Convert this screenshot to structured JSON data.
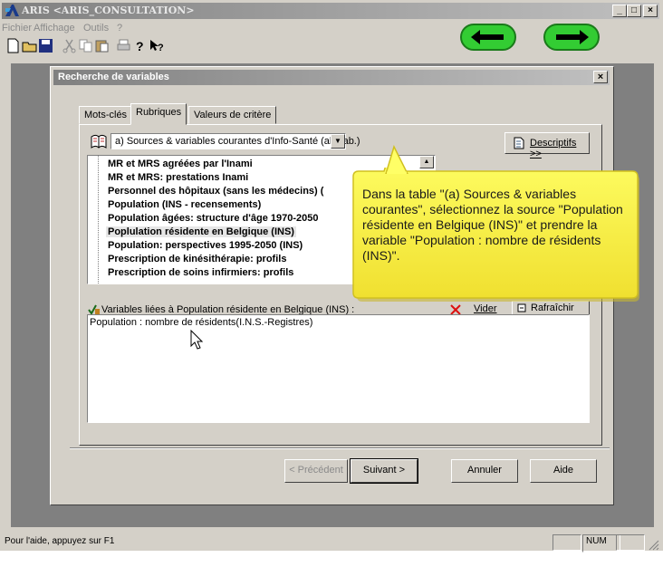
{
  "app": {
    "title": "ARIS <ARIS_CONSULTATION>",
    "menu": [
      "Fichier",
      "Affichage",
      "Outils",
      "?"
    ],
    "window_buttons": [
      "_",
      "□",
      "×"
    ]
  },
  "dialog": {
    "title": "Recherche de variables",
    "close": "×",
    "tabs": [
      "Mots-clés",
      "Rubriques",
      "Valeurs de critère"
    ],
    "combo_value": "a)  Sources & variables courantes d'Info-Santé (alphab.)",
    "descriptifs_button": "Descriptifs >>",
    "tree_items": [
      "MR et MRS agréées par l'Inami",
      "MR et MRS: prestations Inami",
      "Personnel des hôpitaux (sans les médecins) (",
      "Population (INS - recensements)",
      "Population âgées: structure d'âge 1970-2050",
      "Poplulation résidente en Belgique (INS)",
      "Population: perspectives 1995-2050 (INS)",
      "Prescription de kinésithérapie: profils",
      "Prescription de soins infirmiers: profils"
    ],
    "selected_index": 5,
    "vars_label": "Variables liées à Population résidente en Belgique (INS) :",
    "vider_button": "Vider",
    "rafraichir_button": "Rafraîchir",
    "vars_items": [
      "Population : nombre de résidents(I.N.S.-Registres)"
    ],
    "buttons": {
      "prev": "< Précédent",
      "next": "Suivant >",
      "cancel": "Annuler",
      "help": "Aide"
    }
  },
  "tooltip": "Dans la table \"(a) Sources & variables courantes\", sélectionnez la source \"Population résidente en Belgique (INS)\" et prendre la variable \"Population : nombre de résidents (INS)\".",
  "status": {
    "text": "Pour l'aide, appuyez sur F1",
    "num": "NUM"
  },
  "colors": {
    "window_face": "#d4d0c8",
    "callout_fill": "#ffff66",
    "nav_green": "#33cc33"
  }
}
